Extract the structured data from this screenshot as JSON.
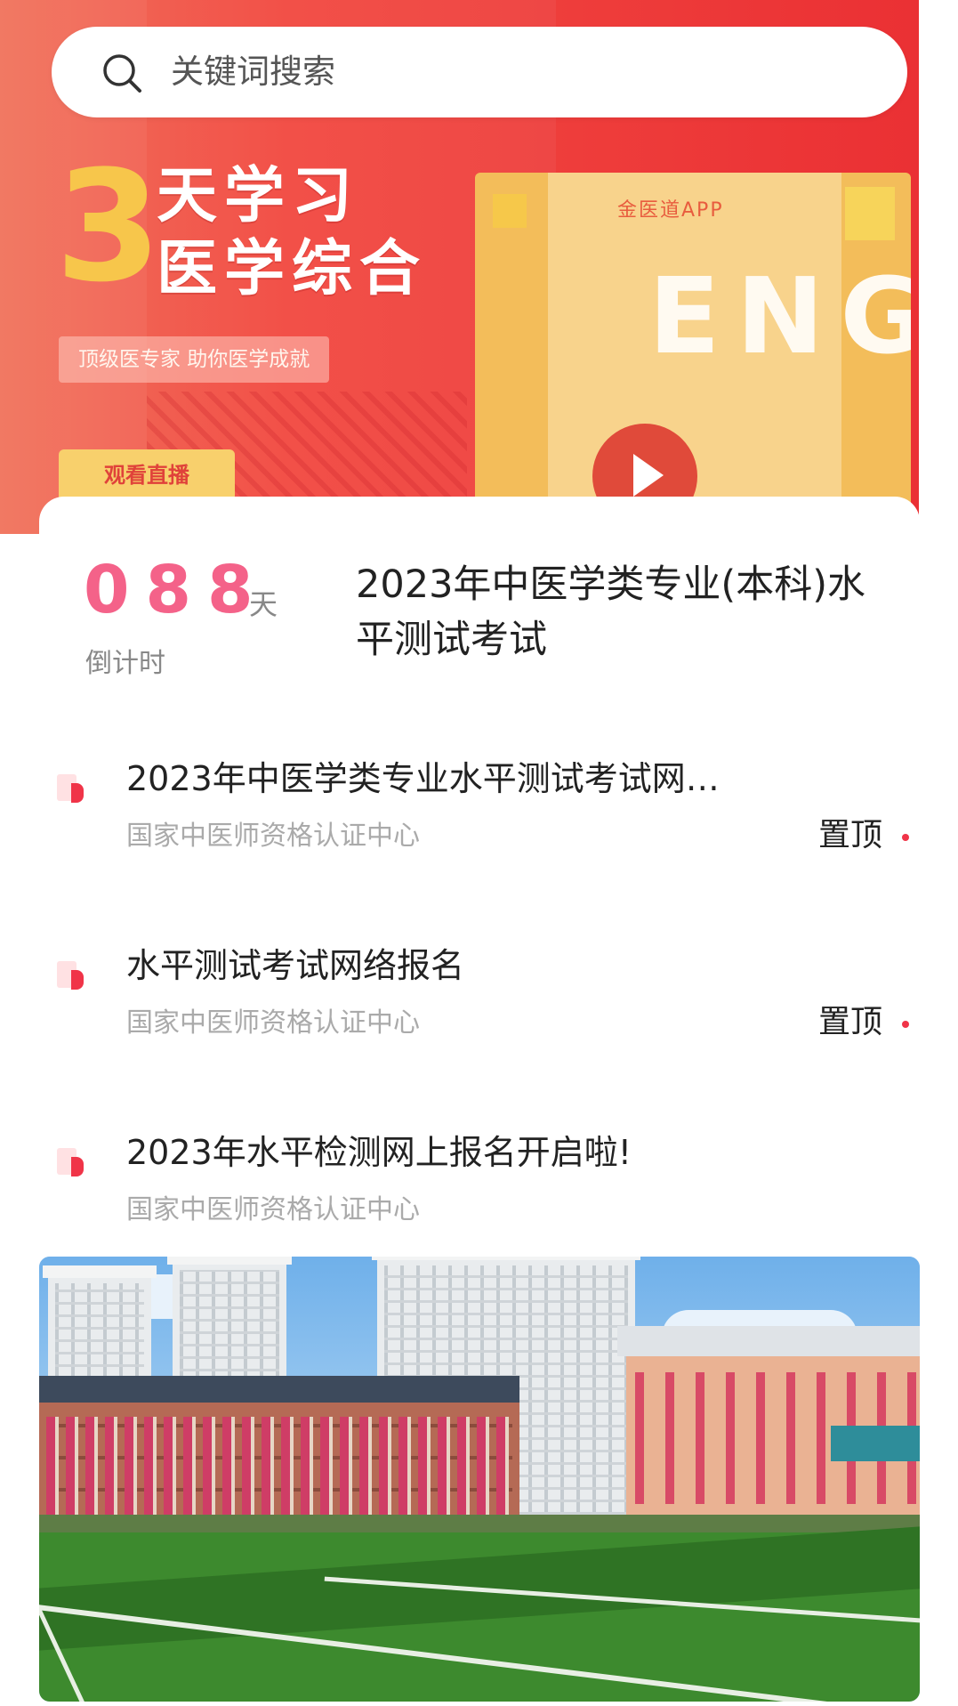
{
  "search": {
    "placeholder": "关键词搜索"
  },
  "banner": {
    "big_number": "3",
    "title_line1": "天学习",
    "title_line2": "医学综合",
    "subtitle": "顶级医专家  助你医学成就",
    "live_button": "观看直播",
    "poster_app_label": "金医道APP",
    "poster_word": "ENGI"
  },
  "countdown": {
    "digits": "088",
    "unit": "天",
    "label": "倒计时",
    "exam_title": "2023年中医学类专业(本科)水平测试考试"
  },
  "news": [
    {
      "title": "2023年中医学类专业水平测试考试网…",
      "source": "国家中医师资格认证中心",
      "pin": "置顶"
    },
    {
      "title": "水平测试考试网络报名",
      "source": "国家中医师资格认证中心",
      "pin": "置顶"
    },
    {
      "title": "2023年水平检测网上报名开启啦!",
      "source": "国家中医师资格认证中心",
      "pin": ""
    }
  ],
  "colors": {
    "banner_red": "#ee3d3b",
    "accent_yellow": "#f7c64b",
    "countdown_pink": "#f46289",
    "bullet_red": "#f03448"
  },
  "icons": {
    "search": "search-icon",
    "bullet": "news-bullet-icon",
    "play": "play-icon"
  }
}
